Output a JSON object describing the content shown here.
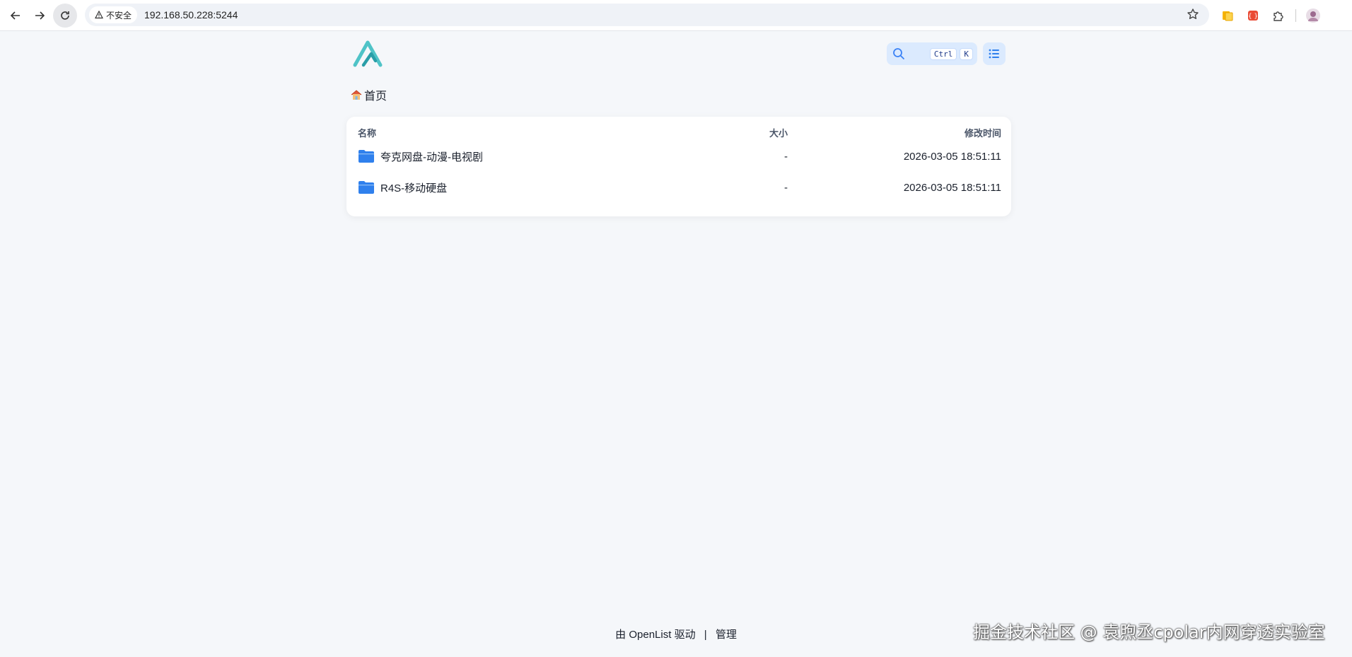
{
  "browser": {
    "security_label": "不安全",
    "url": "192.168.50.228:5244"
  },
  "header": {
    "search_kbd": [
      "Ctrl",
      "K"
    ]
  },
  "breadcrumb": {
    "home_label": "首页"
  },
  "file_list": {
    "columns": {
      "name": "名称",
      "size": "大小",
      "modified": "修改时间"
    },
    "rows": [
      {
        "name": "夸克网盘-动漫-电视剧",
        "size": "-",
        "modified": "2026-03-05 18:51:11"
      },
      {
        "name": "R4S-移动硬盘",
        "size": "-",
        "modified": "2026-03-05 18:51:11"
      }
    ]
  },
  "footer": {
    "prefix": "由",
    "brand": "OpenList",
    "suffix": "驱动",
    "separator": "|",
    "admin_link": "管理"
  },
  "watermark": "掘金技术社区 @ 袁煦丞cpolar内网穿透实验室",
  "colors": {
    "accent": "#3b82f6",
    "folder": "#2f80ed",
    "background": "#f5f7fa"
  }
}
